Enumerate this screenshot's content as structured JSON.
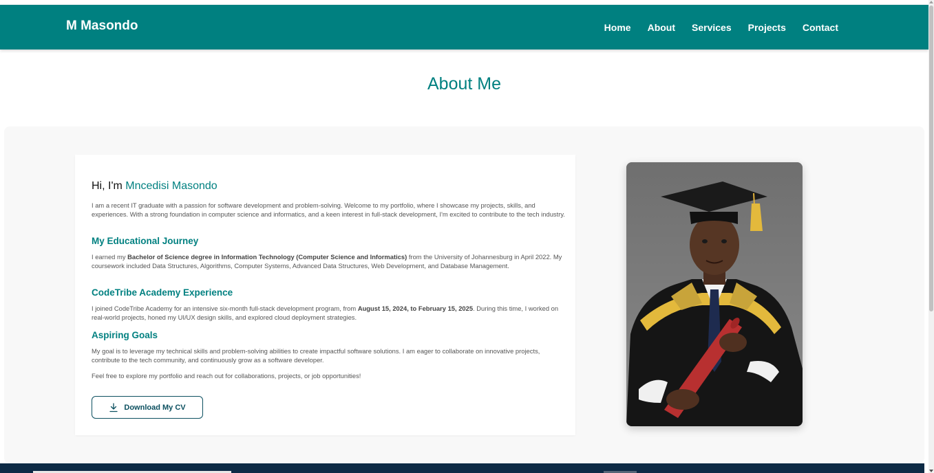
{
  "brand": "M Masondo",
  "nav": [
    "Home",
    "About",
    "Services",
    "Projects",
    "Contact"
  ],
  "page_title": "About Me",
  "about": {
    "greeting_prefix": "Hi, I'm ",
    "greeting_name": "Mncedisi Masondo",
    "intro": "I am a recent IT graduate with a passion for software development and problem-solving. Welcome to my portfolio, where I showcase my projects, skills, and experiences. With a strong foundation in computer science and informatics, and a keen interest in full-stack development, I'm excited to contribute to the tech industry.",
    "education_heading": "My Educational Journey",
    "education_pre": "I earned my ",
    "education_bold": "Bachelor of Science degree in Information Technology (Computer Science and Informatics)",
    "education_post": " from the University of Johannesburg in April 2022. My coursework included Data Structures, Algorithms, Computer Systems, Advanced Data Structures, Web Development, and Database Management.",
    "codetribe_heading": "CodeTribe Academy Experience",
    "codetribe_pre": "I joined CodeTribe Academy for an intensive six-month full-stack development program, from ",
    "codetribe_bold": "August 15, 2024, to February 15, 2025",
    "codetribe_post": ". During this time, I worked on real-world projects, honed my UI/UX design skills, and explored cloud deployment strategies.",
    "goals_heading": "Aspiring Goals",
    "goals_text": "My goal is to leverage my technical skills and problem-solving abilities to create impactful software solutions. I am eager to collaborate on innovative projects, contribute to the tech community, and continuously grow as a software developer.",
    "closing": "Feel free to explore my portfolio and reach out for collaborations, projects, or job opportunities!",
    "cv_button": "Download My CV",
    "cv_icon": "download-icon"
  },
  "colors": {
    "primary": "#008080",
    "dark_navy": "#0d2a45",
    "section_bg": "#f8f8f8"
  }
}
